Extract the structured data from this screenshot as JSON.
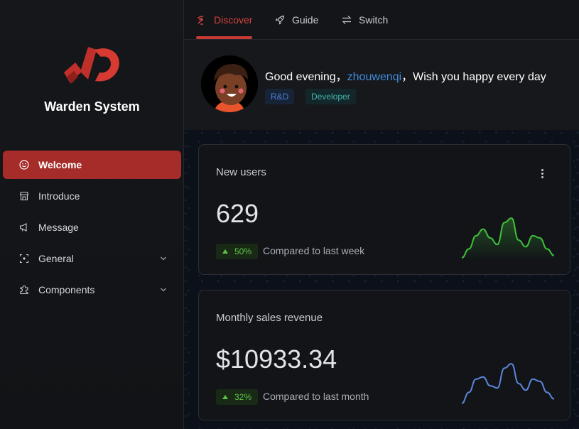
{
  "app": {
    "title": "Warden System"
  },
  "colors": {
    "accent": "#a52c28",
    "tab_active": "#d7423a",
    "link": "#3f8bd9",
    "positive": "#5fc24a",
    "spark_green": "#3fbf3a",
    "spark_blue": "#5a86d8"
  },
  "sidebar": {
    "items": [
      {
        "label": "Welcome",
        "icon": "smile-icon",
        "active": true
      },
      {
        "label": "Introduce",
        "icon": "store-icon"
      },
      {
        "label": "Message",
        "icon": "megaphone-icon"
      },
      {
        "label": "General",
        "icon": "scan-icon",
        "expandable": true
      },
      {
        "label": "Components",
        "icon": "puzzle-icon",
        "expandable": true
      }
    ]
  },
  "tabs": [
    {
      "label": "Discover",
      "icon": "radar-icon",
      "active": true
    },
    {
      "label": "Guide",
      "icon": "rocket-icon"
    },
    {
      "label": "Switch",
      "icon": "swap-icon"
    }
  ],
  "greeting": {
    "prefix": "Good evening，",
    "username": "zhouwenqi",
    "suffix": "，Wish you happy every day",
    "tags": [
      "R&D",
      "Developer"
    ]
  },
  "cards": [
    {
      "title": "New users",
      "value": "629",
      "delta": "50%",
      "compare": "Compared to last week",
      "trend": [
        0.05,
        0.25,
        0.55,
        0.7,
        0.5,
        0.35,
        0.85,
        0.95,
        0.45,
        0.3,
        0.55,
        0.5,
        0.25,
        0.1
      ]
    },
    {
      "title": "Monthly sales revenue",
      "value": "$10933.34",
      "delta": "32%",
      "compare": "Compared to last month",
      "trend": [
        0.05,
        0.3,
        0.6,
        0.65,
        0.45,
        0.4,
        0.85,
        0.95,
        0.5,
        0.35,
        0.6,
        0.55,
        0.3,
        0.15
      ]
    }
  ]
}
